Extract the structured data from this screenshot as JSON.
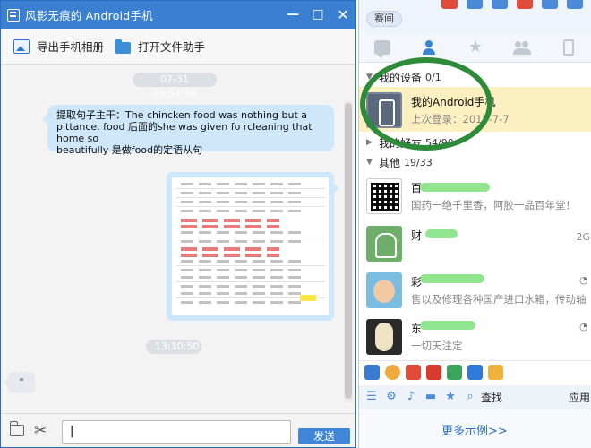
{
  "chat_window": {
    "title": "风影无痕的 Android手机",
    "controls": {
      "minimize": "—",
      "maximize": "□",
      "close": "✕"
    },
    "toolbar": {
      "export_album_label": "导出手机相册",
      "open_file_helper_label": "打开文件助手"
    },
    "messages": [
      {
        "type": "timestamp",
        "text": "07-31 14:57:36"
      },
      {
        "type": "text",
        "direction": "incoming",
        "line1": "提取句子主干：The chincken food was nothing but a",
        "line2": "pittance. food 后面的she was given fo rcleaning that home so",
        "line3": "beautifully 是做food的定语从句"
      },
      {
        "type": "image",
        "direction": "outgoing",
        "description": "spreadsheet screenshot"
      },
      {
        "type": "timestamp",
        "text": "13:10:50"
      },
      {
        "type": "text",
        "direction": "incoming",
        "text": "\""
      }
    ],
    "composer": {
      "input_value": "|",
      "send_label": "发送"
    }
  },
  "side_panel": {
    "rank_tag": "赛间",
    "tabs": [
      "conversations",
      "contacts",
      "favorites",
      "groups",
      "devices"
    ],
    "active_tab": "contacts",
    "groups": [
      {
        "label": "我的设备",
        "count": "0/1",
        "expanded": true
      },
      {
        "label": "我的好友",
        "count": "54/90",
        "expanded": false
      },
      {
        "label": "其他",
        "count": "19/33",
        "expanded": true
      }
    ],
    "contacts": [
      {
        "name": "我的Android手机",
        "sub": "上次登录：2015-7-7",
        "avatar": "phone-avatar",
        "selected": true
      },
      {
        "name": "百",
        "sub": "国药一绝千里香，阿胶一品百年堂！",
        "avatar": "qr-avatar"
      },
      {
        "name": "财",
        "sub": "",
        "right": "2G",
        "avatar": "ghost-avatar"
      },
      {
        "name": "彩",
        "sub": "售以及修理各种国产进口水箱，传动轴",
        "avatar": "child-avatar"
      },
      {
        "name": "东",
        "sub": "一切天注定",
        "avatar": "penguin-avatar"
      }
    ],
    "bottom_tools": {
      "search_label": "查找",
      "app_label": "应用"
    },
    "more_link": "更多示例>>"
  },
  "colors": {
    "titlebar": "#3a7fd0",
    "bubble": "#cfe7fa",
    "selected_row": "#fcf0c0",
    "annotation_circle": "#2e8b3a",
    "send_button": "#3f86d9"
  }
}
